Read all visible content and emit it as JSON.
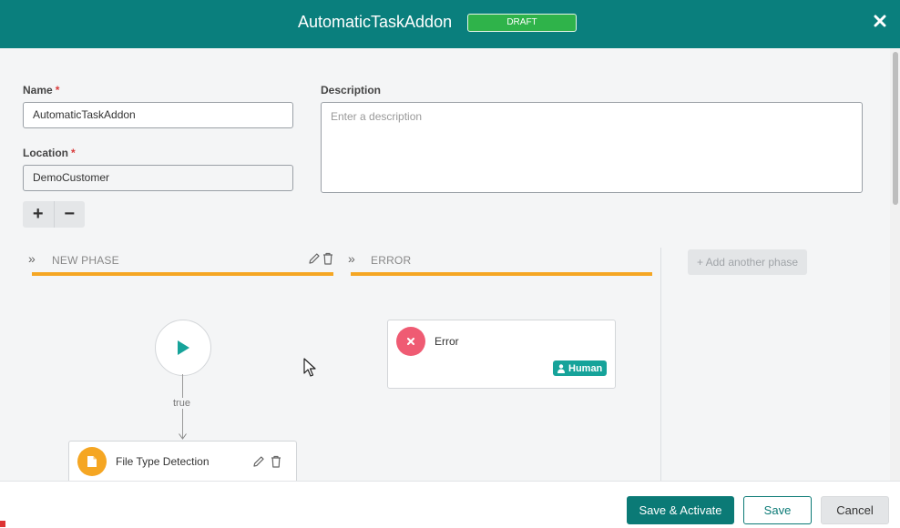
{
  "header": {
    "title": "AutomaticTaskAddon",
    "status_badge": "DRAFT",
    "close_icon": "close-icon"
  },
  "form": {
    "name_label": "Name",
    "name_value": "AutomaticTaskAddon",
    "location_label": "Location",
    "location_value": "DemoCustomer",
    "required_marker": "*",
    "description_label": "Description",
    "description_placeholder": "Enter a description"
  },
  "zoom": {
    "plus": "+",
    "minus": "−"
  },
  "phases": [
    {
      "title": "NEW PHASE",
      "chevron": "»"
    },
    {
      "title": "ERROR",
      "chevron": "»"
    }
  ],
  "add_phase_label": "+ Add another phase",
  "flow": {
    "edge_label": "true",
    "file_node": {
      "title": "File Type Detection"
    },
    "error_node": {
      "title": "Error",
      "badge": "Human"
    }
  },
  "footer": {
    "save_activate": "Save & Activate",
    "save": "Save",
    "cancel": "Cancel"
  },
  "colors": {
    "header": "#0a7f7d",
    "draft": "#2fb34a",
    "phase_bar": "#f5a623",
    "start_play": "#16a39a",
    "error_node": "#ef5b73",
    "file_node": "#f5a623",
    "human_badge": "#16a39a",
    "primary_button": "#0b7a76"
  }
}
